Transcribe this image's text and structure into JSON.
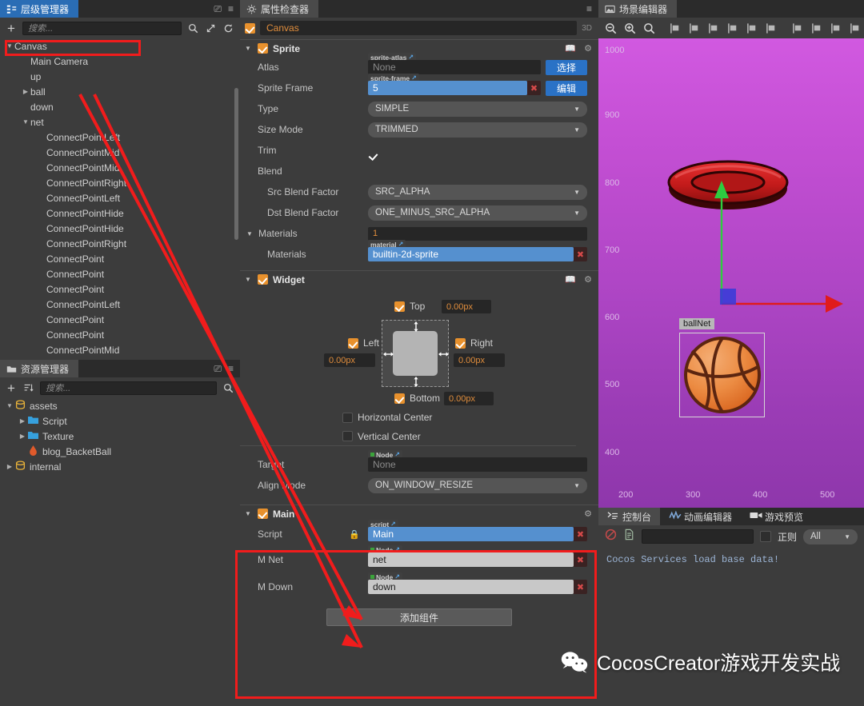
{
  "hierarchy": {
    "tab_label": "层级管理器",
    "search_placeholder": "搜索...",
    "icons": [
      "add-icon",
      "search-icon",
      "expand-icon",
      "refresh-icon",
      "link-icon",
      "menu-icon"
    ],
    "items": [
      {
        "label": "Canvas",
        "depth": 0,
        "arrow": "down",
        "selected": true
      },
      {
        "label": "Main Camera",
        "depth": 1,
        "arrow": "none"
      },
      {
        "label": "up",
        "depth": 1,
        "arrow": "none"
      },
      {
        "label": "ball",
        "depth": 1,
        "arrow": "right"
      },
      {
        "label": "down",
        "depth": 1,
        "arrow": "none"
      },
      {
        "label": "net",
        "depth": 1,
        "arrow": "down"
      },
      {
        "label": "ConnectPointLeft",
        "depth": 2,
        "arrow": "none"
      },
      {
        "label": "ConnectPointMid",
        "depth": 2,
        "arrow": "none"
      },
      {
        "label": "ConnectPointMid",
        "depth": 2,
        "arrow": "none"
      },
      {
        "label": "ConnectPointRight",
        "depth": 2,
        "arrow": "none"
      },
      {
        "label": "ConnectPointLeft",
        "depth": 2,
        "arrow": "none"
      },
      {
        "label": "ConnectPointHide",
        "depth": 2,
        "arrow": "none"
      },
      {
        "label": "ConnectPointHide",
        "depth": 2,
        "arrow": "none"
      },
      {
        "label": "ConnectPointRight",
        "depth": 2,
        "arrow": "none"
      },
      {
        "label": "ConnectPoint",
        "depth": 2,
        "arrow": "none"
      },
      {
        "label": "ConnectPoint",
        "depth": 2,
        "arrow": "none"
      },
      {
        "label": "ConnectPoint",
        "depth": 2,
        "arrow": "none"
      },
      {
        "label": "ConnectPointLeft",
        "depth": 2,
        "arrow": "none"
      },
      {
        "label": "ConnectPoint",
        "depth": 2,
        "arrow": "none"
      },
      {
        "label": "ConnectPoint",
        "depth": 2,
        "arrow": "none"
      },
      {
        "label": "ConnectPointMid",
        "depth": 2,
        "arrow": "none"
      }
    ]
  },
  "assets": {
    "tab_label": "资源管理器",
    "search_placeholder": "搜索...",
    "items": [
      {
        "label": "assets",
        "depth": 0,
        "arrow": "down",
        "icon": "db-icon"
      },
      {
        "label": "Script",
        "depth": 1,
        "arrow": "right",
        "icon": "folder-icon"
      },
      {
        "label": "Texture",
        "depth": 1,
        "arrow": "right",
        "icon": "folder-icon"
      },
      {
        "label": "blog_BacketBall",
        "depth": 1,
        "arrow": "none",
        "icon": "scene-icon"
      },
      {
        "label": "internal",
        "depth": 0,
        "arrow": "right",
        "icon": "db-icon"
      }
    ]
  },
  "inspector": {
    "tab_label": "属性检查器",
    "node_name": "Canvas",
    "badge_3d": "3D",
    "node_enabled": true,
    "sprite": {
      "title": "Sprite",
      "enabled": true,
      "atlas_label": "Atlas",
      "atlas_tag": "sprite-atlas",
      "atlas_value": "None",
      "atlas_button": "选择",
      "frame_label": "Sprite Frame",
      "frame_tag": "sprite-frame",
      "frame_value": "5",
      "frame_button": "编辑",
      "type_label": "Type",
      "type_value": "SIMPLE",
      "sizemode_label": "Size Mode",
      "sizemode_value": "TRIMMED",
      "trim_label": "Trim",
      "trim_checked": true,
      "blend_label": "Blend",
      "src_blend_label": "Src Blend Factor",
      "src_blend_value": "SRC_ALPHA",
      "dst_blend_label": "Dst Blend Factor",
      "dst_blend_value": "ONE_MINUS_SRC_ALPHA",
      "materials_label": "Materials",
      "materials_count": "1",
      "materials_item_label": "Materials",
      "materials_tag": "material",
      "materials_value": "builtin-2d-sprite"
    },
    "widget": {
      "title": "Widget",
      "enabled": true,
      "top_label": "Top",
      "top_value": "0.00px",
      "top_checked": true,
      "left_label": "Left",
      "left_value": "0.00px",
      "left_checked": true,
      "right_label": "Right",
      "right_value": "0.00px",
      "right_checked": true,
      "bottom_label": "Bottom",
      "bottom_value": "0.00px",
      "bottom_checked": true,
      "hcenter_label": "Horizontal Center",
      "hcenter_checked": false,
      "vcenter_label": "Vertical Center",
      "vcenter_checked": false,
      "target_label": "Target",
      "target_tag": "Node",
      "target_value": "None",
      "alignmode_label": "Align Mode",
      "alignmode_value": "ON_WINDOW_RESIZE"
    },
    "main": {
      "title": "Main",
      "enabled": true,
      "script_label": "Script",
      "script_tag": "script",
      "script_value": "Main",
      "mnet_label": "M Net",
      "mnet_tag": "Node",
      "mnet_value": "net",
      "mdown_label": "M Down",
      "mdown_tag": "Node",
      "mdown_value": "down"
    },
    "add_component_button": "添加组件"
  },
  "scene": {
    "tab_label": "场景编辑器",
    "toolbar_icons": [
      "zoom-out-icon",
      "zoom-in-icon",
      "zoom-reset-icon",
      "align-left-icon",
      "align-hcenter-icon",
      "align-right-icon",
      "dist-left-icon",
      "dist-hcenter-icon",
      "dist-right-icon",
      "align-top-icon",
      "align-vcenter-icon",
      "align-bottom-icon",
      "dist-vertical-icon"
    ],
    "node_tag": "ballNet",
    "y_labels": [
      "1000",
      "900",
      "800",
      "700",
      "600",
      "500",
      "400"
    ],
    "x_labels": [
      "200",
      "300",
      "400",
      "500"
    ],
    "gizmo": {
      "x_axis_color": "#e01b1b",
      "y_axis_color": "#2ecc40",
      "handle_color": "#3b3bd8"
    }
  },
  "console": {
    "tabs": [
      {
        "label": "控制台",
        "icon": "console-icon",
        "active": true
      },
      {
        "label": "动画编辑器",
        "icon": "animation-icon",
        "active": false
      },
      {
        "label": "游戏预览",
        "icon": "preview-icon",
        "active": false
      }
    ],
    "clear_icon": "clear-icon",
    "file_icon": "file-icon",
    "filter_value": "",
    "regex_label": "正则",
    "regex_checked": false,
    "level_value": "All",
    "log_lines": [
      "Cocos Services load base data!"
    ]
  },
  "watermark": {
    "text": "CocosCreator游戏开发实战",
    "icon": "wechat-icon"
  },
  "annotation": {
    "color": "#f11c1c"
  }
}
